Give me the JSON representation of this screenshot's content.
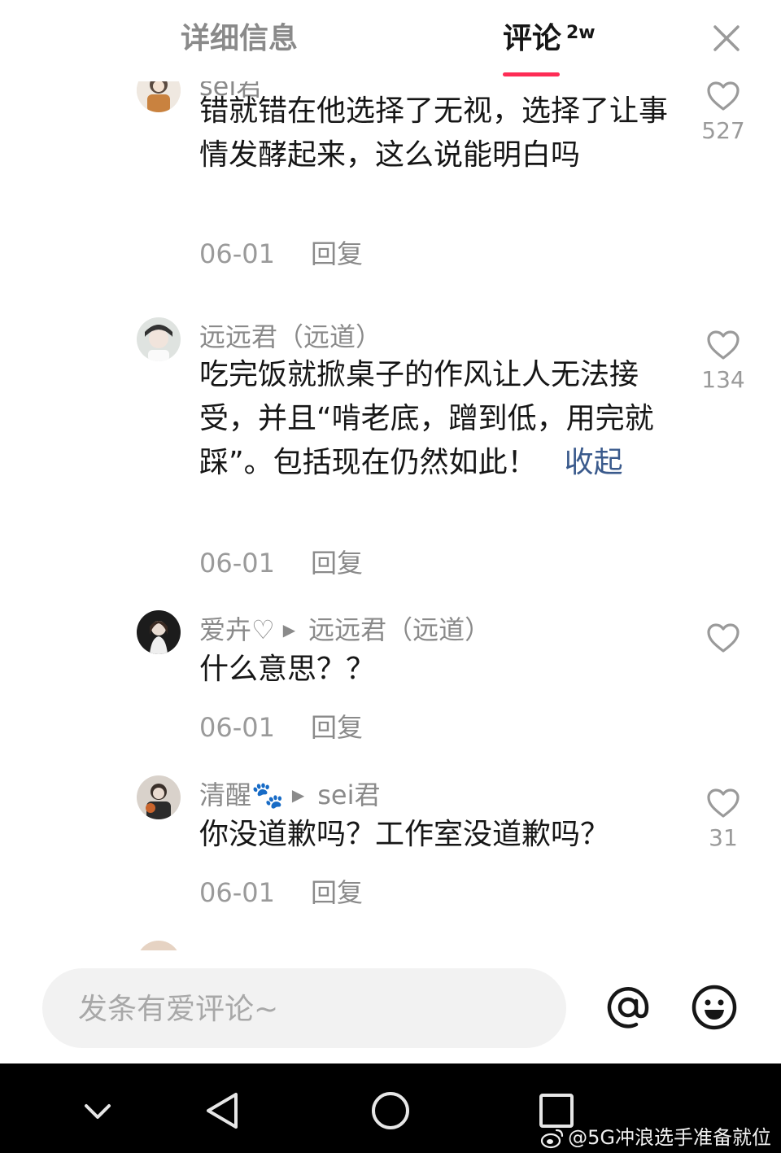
{
  "header": {
    "tab_details": "详细信息",
    "tab_comments": "评论",
    "comment_count": "2w"
  },
  "comments": [
    {
      "author": "sei君",
      "text": "错就错在他选择了无视，选择了让事情发酵起来，这么说能明白吗",
      "date": "06-01",
      "reply": "回复",
      "likes": "527"
    },
    {
      "author": "远远君（远道）",
      "text": "吃完饭就掀桌子的作风让人无法接受，并且“啃老底，蹭到低，用完就踩”。包括现在仍然如此！",
      "collapse": "收起",
      "date": "06-01",
      "reply": "回复",
      "likes": "134"
    },
    {
      "author": "爱卉♡",
      "reply_to": "远远君（远道）",
      "text": "什么意思？？",
      "date": "06-01",
      "reply": "回复",
      "likes": ""
    },
    {
      "author": "清醒🐾",
      "reply_to": "sei君",
      "text": "你没道歉吗？工作室没道歉吗？",
      "date": "06-01",
      "reply": "回复",
      "likes": "31"
    }
  ],
  "input": {
    "placeholder": "发条有爱评论~"
  },
  "watermark": "@5G冲浪选手准备就位",
  "colors": {
    "accent": "#fe2c55",
    "link": "#3a5a8c",
    "muted": "#9a9a9a",
    "navbar": "#000000"
  },
  "icons": [
    "close-icon",
    "heart-icon",
    "at-icon",
    "emoji-icon",
    "back-icon",
    "home-icon",
    "recents-icon",
    "chevron-down-icon",
    "weibo-icon"
  ]
}
